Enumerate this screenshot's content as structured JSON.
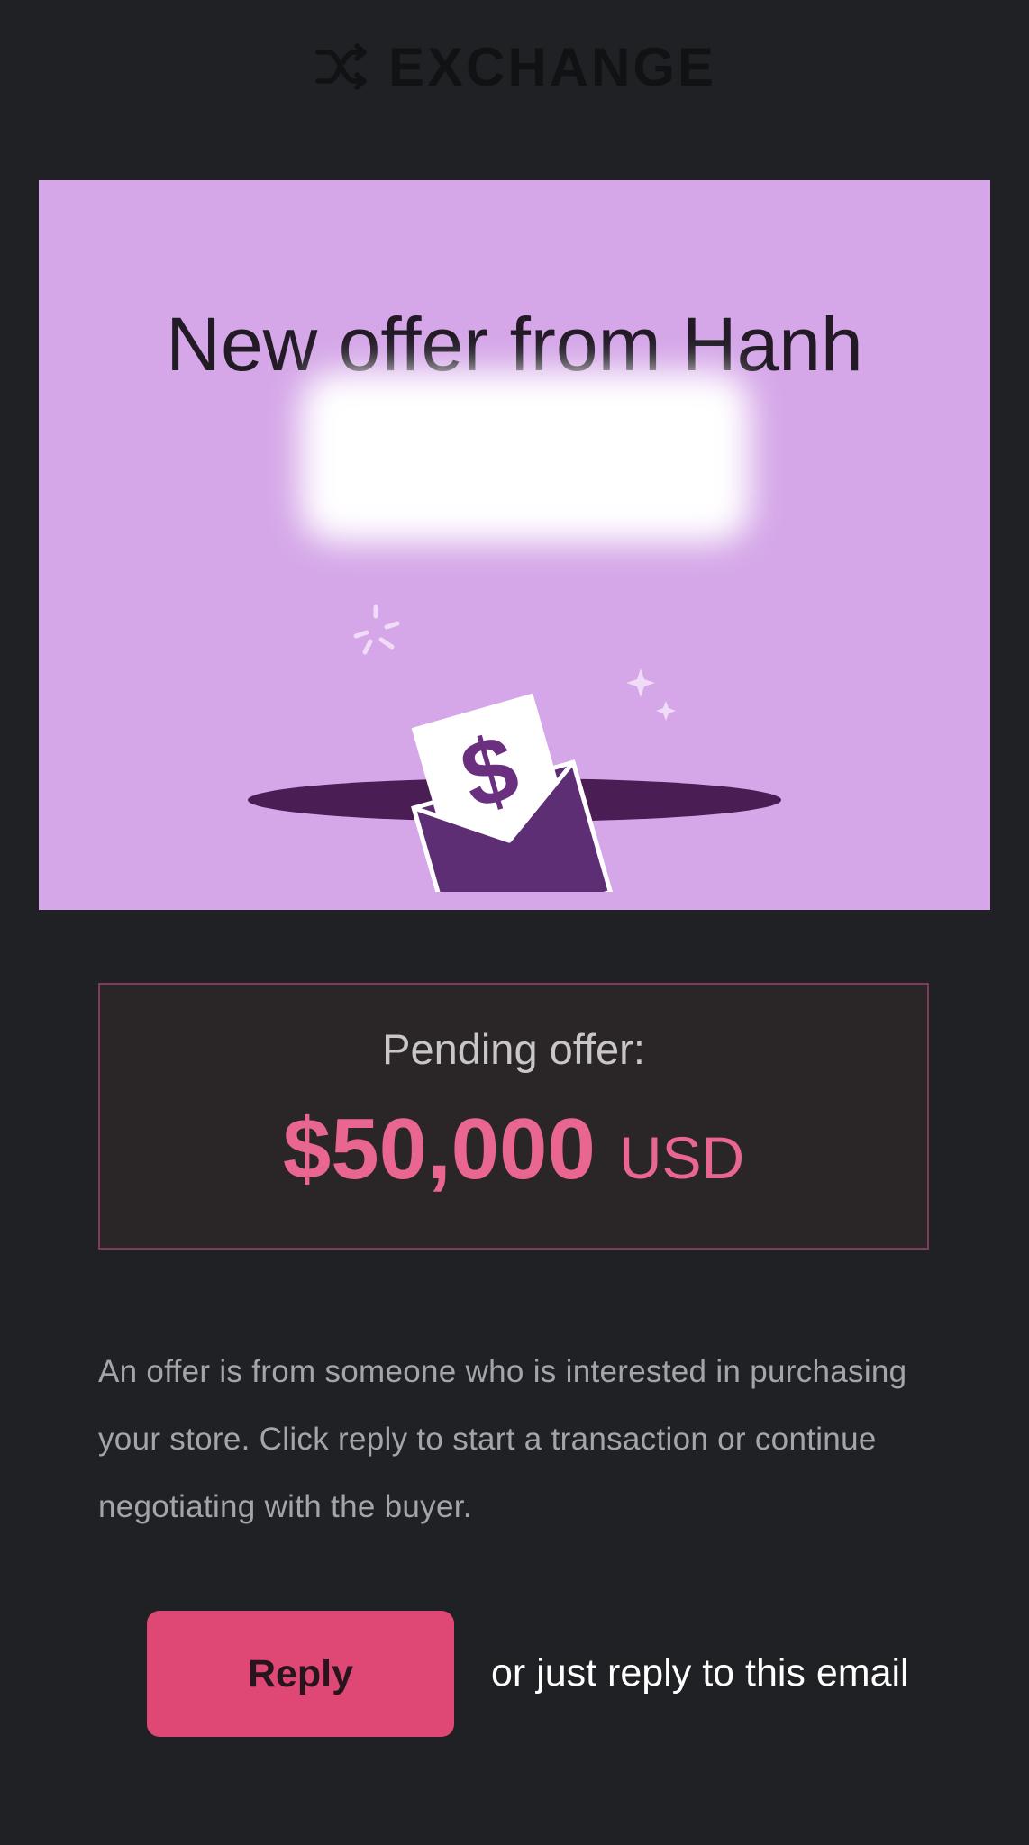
{
  "header": {
    "brand_name": "EXCHANGE",
    "logo_icon": "shuffle-icon"
  },
  "hero": {
    "title": "New offer from Hanh",
    "illustration": "envelope-money-icon",
    "background_color": "#d5a7e8"
  },
  "offer": {
    "label": "Pending offer:",
    "amount": "$50,000",
    "currency": "USD",
    "accent_color": "#e8668f"
  },
  "description": {
    "text": "An offer is from someone who is interested in purchasing your store. Click reply to start a transaction or continue negotiating with the buyer."
  },
  "cta": {
    "reply_label": "Reply",
    "hint": "or just reply to this email",
    "button_color": "#df4875"
  }
}
